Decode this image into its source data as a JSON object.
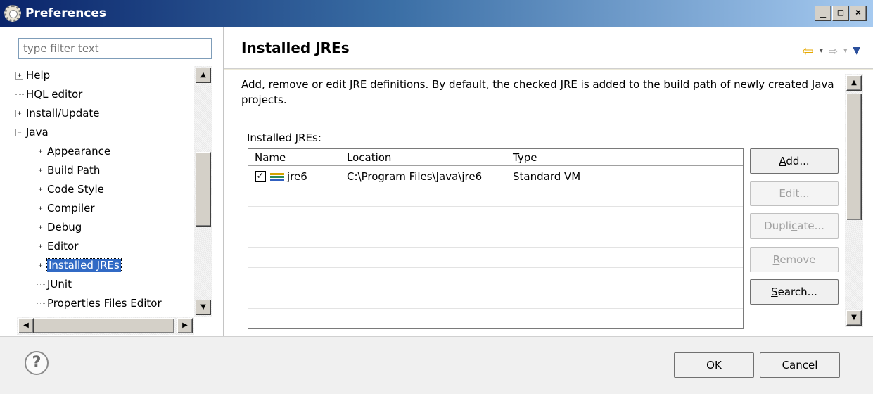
{
  "window": {
    "title": "Preferences",
    "minimize": "_",
    "maximize": "□",
    "close": "×"
  },
  "filter": {
    "placeholder": "type filter text"
  },
  "tree": {
    "items": [
      {
        "label": "Help",
        "level": 0,
        "expander": "+"
      },
      {
        "label": "HQL editor",
        "level": 0,
        "expander": ""
      },
      {
        "label": "Install/Update",
        "level": 0,
        "expander": "+"
      },
      {
        "label": "Java",
        "level": 0,
        "expander": "−"
      },
      {
        "label": "Appearance",
        "level": 1,
        "expander": "+"
      },
      {
        "label": "Build Path",
        "level": 1,
        "expander": "+"
      },
      {
        "label": "Code Style",
        "level": 1,
        "expander": "+"
      },
      {
        "label": "Compiler",
        "level": 1,
        "expander": "+"
      },
      {
        "label": "Debug",
        "level": 1,
        "expander": "+"
      },
      {
        "label": "Editor",
        "level": 1,
        "expander": "+"
      },
      {
        "label": "Installed JREs",
        "level": 1,
        "expander": "+",
        "selected": true
      },
      {
        "label": "JUnit",
        "level": 1,
        "expander": ""
      },
      {
        "label": "Properties Files Editor",
        "level": 1,
        "expander": ""
      }
    ]
  },
  "page": {
    "title": "Installed JREs",
    "description": "Add, remove or edit JRE definitions. By default, the checked JRE is added to the build path of newly created Java projects.",
    "jre_label_prefix": "Installed ",
    "jre_label_mnemonic": "J",
    "jre_label_suffix": "REs:"
  },
  "table": {
    "columns": [
      "Name",
      "Location",
      "Type",
      ""
    ],
    "rows": [
      {
        "checked": true,
        "name": "jre6",
        "location": "C:\\Program Files\\Java\\jre6",
        "type": "Standard VM"
      }
    ],
    "empty_rows": 7
  },
  "buttons": {
    "add": {
      "label": "Add...",
      "mnemonic": "A",
      "rest": "dd...",
      "enabled": true
    },
    "edit": {
      "label": "Edit...",
      "mnemonic": "E",
      "rest": "dit...",
      "enabled": false
    },
    "duplicate": {
      "label": "Duplicate...",
      "pre": "Dupli",
      "mnemonic": "c",
      "rest": "ate...",
      "enabled": false
    },
    "remove": {
      "label": "Remove",
      "mnemonic": "R",
      "rest": "emove",
      "enabled": false
    },
    "search": {
      "label": "Search...",
      "mnemonic": "S",
      "rest": "earch...",
      "enabled": true
    }
  },
  "dialog": {
    "ok": "OK",
    "cancel": "Cancel",
    "help_icon": "?"
  },
  "icons": {
    "back": "⇦",
    "forward": "⇨",
    "dropdown": "▾",
    "menu": "▼"
  }
}
